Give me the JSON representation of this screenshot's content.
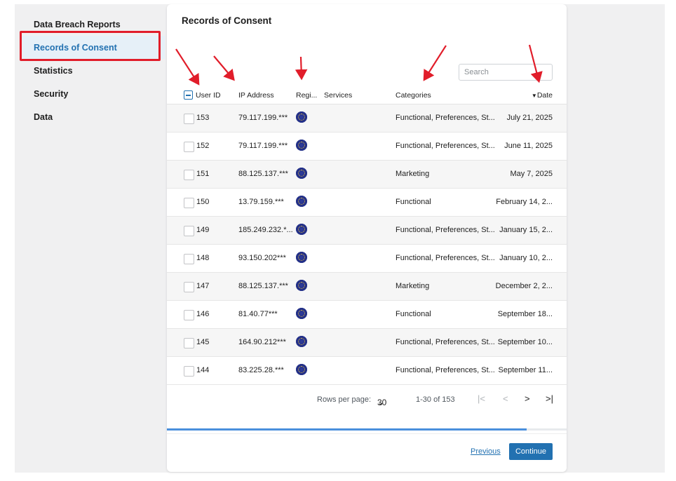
{
  "sidebar": {
    "items": [
      {
        "label": "Data Breach Reports",
        "active": false
      },
      {
        "label": "Records of Consent",
        "active": true
      },
      {
        "label": "Statistics",
        "active": false
      },
      {
        "label": "Security",
        "active": false
      },
      {
        "label": "Data",
        "active": false
      }
    ]
  },
  "card": {
    "title": "Records of Consent",
    "search_placeholder": "Search"
  },
  "table": {
    "columns": {
      "user_id": "User ID",
      "ip": "IP Address",
      "region": "Regi...",
      "services": "Services",
      "categories": "Categories",
      "date": "Date",
      "date_sort_icon": "▼"
    },
    "rows": [
      {
        "id": "153",
        "ip": "79.117.199.***",
        "region_icon": "eu-flag-icon",
        "categories": "Functional, Preferences, St...",
        "date": "July 21, 2025"
      },
      {
        "id": "152",
        "ip": "79.117.199.***",
        "region_icon": "eu-flag-icon",
        "categories": "Functional, Preferences, St...",
        "date": "June 11, 2025"
      },
      {
        "id": "151",
        "ip": "88.125.137.***",
        "region_icon": "eu-flag-icon",
        "categories": "Marketing",
        "date": "May 7, 2025"
      },
      {
        "id": "150",
        "ip": "13.79.159.***",
        "region_icon": "eu-flag-icon",
        "categories": "Functional",
        "date": "February 14, 2..."
      },
      {
        "id": "149",
        "ip": "185.249.232.*...",
        "region_icon": "eu-flag-icon",
        "categories": "Functional, Preferences, St...",
        "date": "January 15, 2..."
      },
      {
        "id": "148",
        "ip": "93.150.202***",
        "region_icon": "eu-flag-icon",
        "categories": "Functional, Preferences, St...",
        "date": "January 10, 2..."
      },
      {
        "id": "147",
        "ip": "88.125.137.***",
        "region_icon": "eu-flag-icon",
        "categories": "Marketing",
        "date": "December 2, 2..."
      },
      {
        "id": "146",
        "ip": "81.40.77***",
        "region_icon": "eu-flag-icon",
        "categories": "Functional",
        "date": "September 18..."
      },
      {
        "id": "145",
        "ip": "164.90.212***",
        "region_icon": "eu-flag-icon",
        "categories": "Functional, Preferences, St...",
        "date": "September 10..."
      },
      {
        "id": "144",
        "ip": "83.225.28.***",
        "region_icon": "eu-flag-icon",
        "categories": "Functional, Preferences, St...",
        "date": "September 11..."
      }
    ]
  },
  "pagination": {
    "rows_per_page_label": "Rows per page:",
    "rows_per_page_value": "30",
    "chevron": "⌄",
    "range": "1-30 of 153",
    "first": "|<",
    "prev": "<",
    "next": ">",
    "last": ">|"
  },
  "progress": {
    "fraction": 0.9
  },
  "footer": {
    "previous_label": "Previous",
    "continue_label": "Continue"
  },
  "colors": {
    "accent": "#2271b1",
    "annotation_red": "#e11d2a",
    "progress_fill": "#4a8fdc"
  }
}
